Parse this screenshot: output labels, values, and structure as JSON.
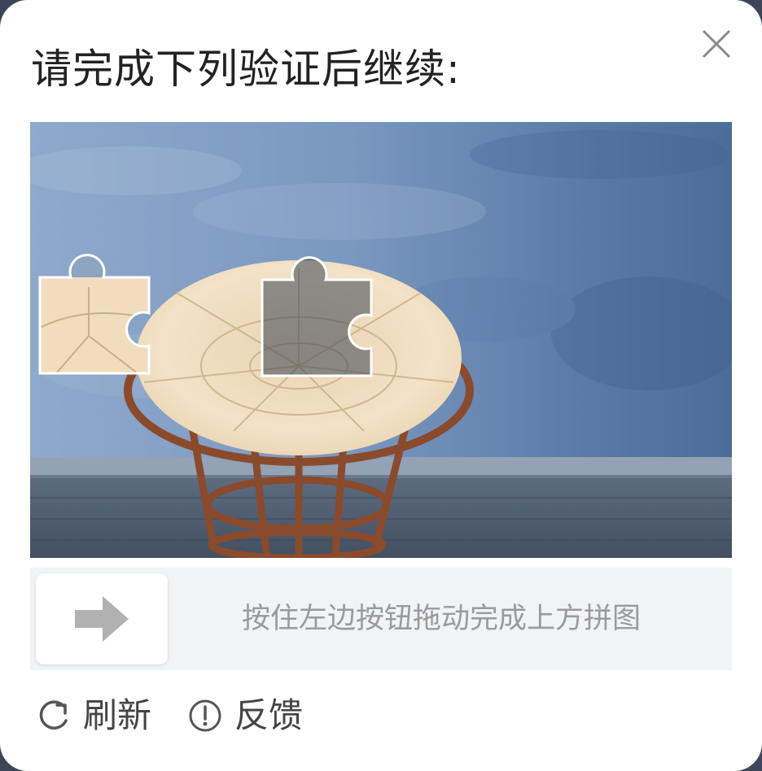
{
  "dialog": {
    "title": "请完成下列验证后继续:"
  },
  "captcha": {
    "slider_hint": "按住左边按钮拖动完成上方拼图"
  },
  "footer": {
    "refresh_label": "刷新",
    "feedback_label": "反馈"
  },
  "icons": {
    "close": "close-icon",
    "arrow": "arrow-right-icon",
    "refresh": "refresh-icon",
    "feedback": "exclamation-circle-icon"
  },
  "colors": {
    "wall": "#6f8fb6",
    "floor": "#4d5a6e",
    "chair_frame": "#8a4a2c",
    "cushion": "#f1dfc3",
    "slider_track": "#f2f3f5",
    "hint_text": "#9a9a9a"
  }
}
